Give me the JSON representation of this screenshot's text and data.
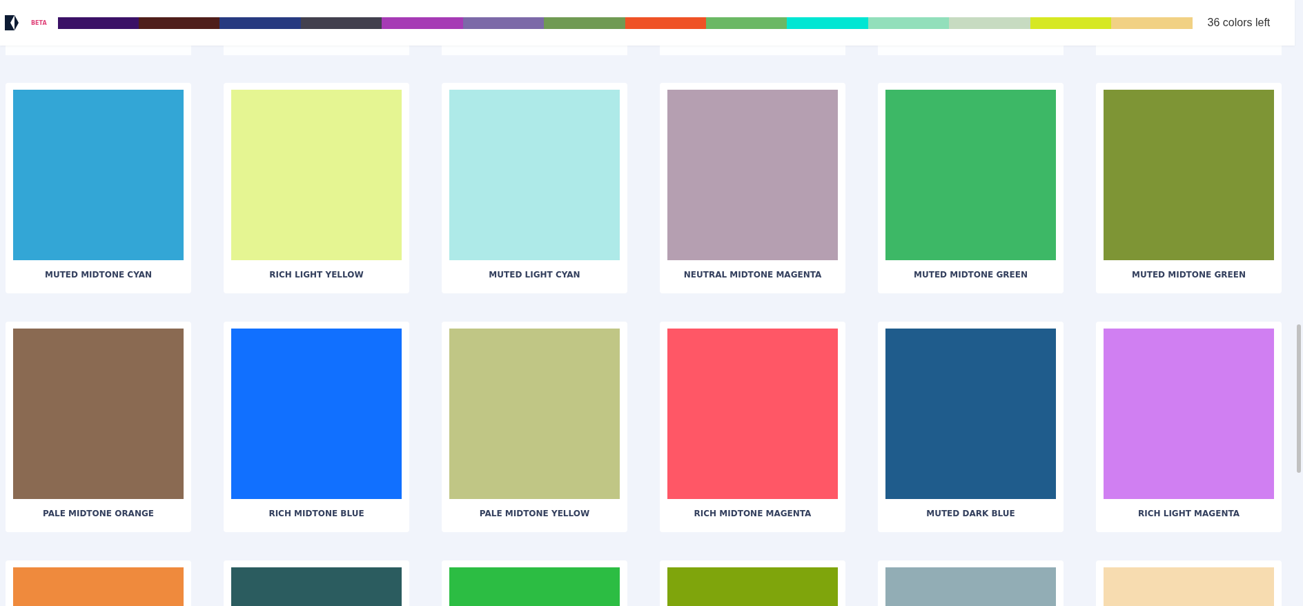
{
  "header": {
    "badge": "BETA",
    "palette": [
      {
        "color": "#3b1166"
      },
      {
        "color": "#4f1e1b"
      },
      {
        "color": "#273a80"
      },
      {
        "color": "#42404e"
      },
      {
        "color": "#a63bb5"
      },
      {
        "color": "#7c69a8"
      },
      {
        "color": "#709a53"
      },
      {
        "color": "#ef5225"
      },
      {
        "color": "#6bb864"
      },
      {
        "color": "#00e6d3"
      },
      {
        "color": "#92dfbb"
      },
      {
        "color": "#c7dbc1"
      },
      {
        "color": "#d6e823"
      },
      {
        "color": "#f1d184"
      }
    ],
    "remaining": "36 colors left"
  },
  "rows": [
    {
      "cards": [
        {
          "name": "MUTED MIDTONE CYAN",
          "color": "#33a6d6"
        },
        {
          "name": "RICH LIGHT YELLOW",
          "color": "#e5f592"
        },
        {
          "name": "MUTED LIGHT CYAN",
          "color": "#aeeae8"
        },
        {
          "name": "NEUTRAL MIDTONE MAGENTA",
          "color": "#b59fb1"
        },
        {
          "name": "MUTED MIDTONE GREEN",
          "color": "#3db866"
        },
        {
          "name": "MUTED MIDTONE GREEN",
          "color": "#7e9535"
        }
      ]
    },
    {
      "cards": [
        {
          "name": "PALE MIDTONE ORANGE",
          "color": "#8a6a52"
        },
        {
          "name": "RICH MIDTONE BLUE",
          "color": "#1170ff"
        },
        {
          "name": "PALE MIDTONE YELLOW",
          "color": "#c0c685"
        },
        {
          "name": "RICH MIDTONE MAGENTA",
          "color": "#ff5766"
        },
        {
          "name": "MUTED DARK BLUE",
          "color": "#1f5c8c"
        },
        {
          "name": "RICH LIGHT MAGENTA",
          "color": "#d07ff2"
        }
      ]
    },
    {
      "cards": [
        {
          "color": "#ef8a3d"
        },
        {
          "color": "#2b5c5f"
        },
        {
          "color": "#2cbd43"
        },
        {
          "color": "#7fa50c"
        },
        {
          "color": "#92adb5"
        },
        {
          "color": "#f7dcb0"
        }
      ]
    }
  ]
}
